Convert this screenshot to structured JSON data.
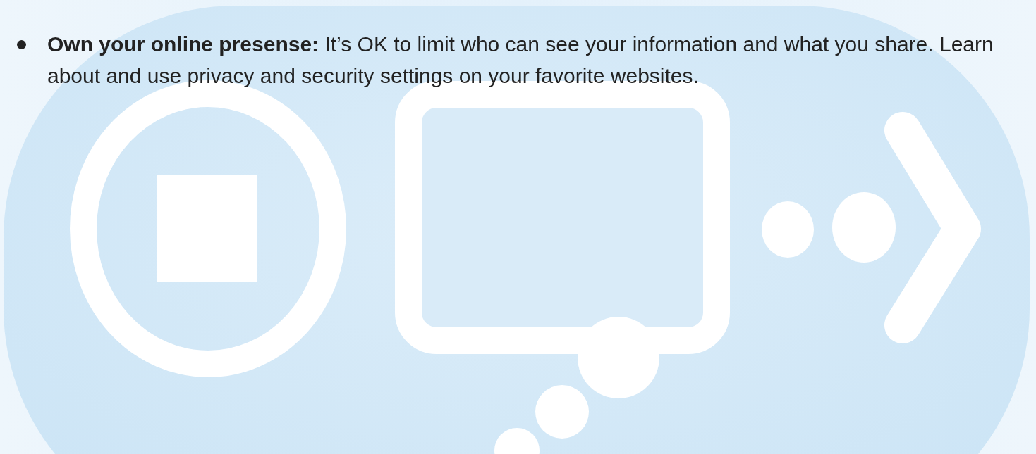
{
  "bullets": [
    {
      "text": "**Own your online presense:** It’s OK to limit who can see your information and what you share. Learn about and use privacy and security settings on your favorite websites."
    }
  ]
}
